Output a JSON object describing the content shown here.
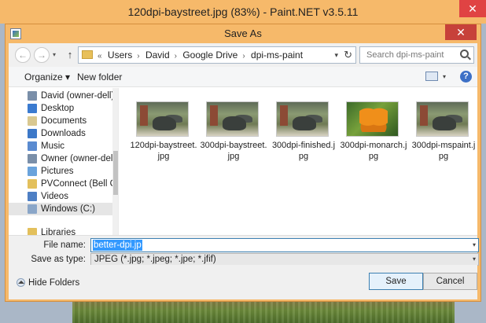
{
  "app": {
    "title": "120dpi-baystreet.jpg (83%) - Paint.NET v3.5.11",
    "close_glyph": "✕"
  },
  "dialog": {
    "title": "Save As",
    "close_glyph": "✕"
  },
  "address_bar": {
    "back_glyph": "←",
    "forward_glyph": "→",
    "up_glyph": "↑",
    "overflow_glyph": "«",
    "crumbs": [
      "Users",
      "David",
      "Google Drive",
      "dpi-ms-paint"
    ],
    "separator_glyph": "›",
    "dropdown_glyph": "▾",
    "refresh_glyph": "↻"
  },
  "search": {
    "placeholder": "Search dpi-ms-paint"
  },
  "toolbar": {
    "organize_label": "Organize ▾",
    "new_folder_label": "New folder",
    "view_dropdown_glyph": "▾",
    "help_glyph": "?"
  },
  "nav_pane": {
    "items": [
      {
        "label": "David (owner-dell)",
        "icon": "user-folder-icon",
        "color": "#7a8fa9"
      },
      {
        "label": "Desktop",
        "icon": "desktop-icon",
        "color": "#3b7bd0"
      },
      {
        "label": "Documents",
        "icon": "documents-icon",
        "color": "#d9c890"
      },
      {
        "label": "Downloads",
        "icon": "downloads-icon",
        "color": "#3c78c8"
      },
      {
        "label": "Music",
        "icon": "music-icon",
        "color": "#5a8bd0"
      },
      {
        "label": "Owner (owner-dell)",
        "icon": "user-folder-icon",
        "color": "#7a8fa9"
      },
      {
        "label": "Pictures",
        "icon": "pictures-icon",
        "color": "#6aa3dc"
      },
      {
        "label": "PVConnect (Bell Conn",
        "icon": "folder-icon",
        "color": "#e3c05c"
      },
      {
        "label": "Videos",
        "icon": "videos-icon",
        "color": "#4e7fc4"
      },
      {
        "label": "Windows (C:)",
        "icon": "drive-icon",
        "color": "#8aa6c8"
      },
      {
        "label": "Libraries",
        "icon": "libraries-icon",
        "color": "#e3c05c"
      }
    ],
    "selected_index": 9
  },
  "files": [
    {
      "label": "120dpi-baystreet.jpg",
      "thumb": "bull"
    },
    {
      "label": "300dpi-baystreet.jpg",
      "thumb": "bull"
    },
    {
      "label": "300dpi-finished.jpg",
      "thumb": "bull"
    },
    {
      "label": "300dpi-monarch.jpg",
      "thumb": "butterfly"
    },
    {
      "label": "300dpi-mspaint.jpg",
      "thumb": "bull"
    }
  ],
  "form": {
    "file_name_label": "File name:",
    "file_name_value": "better-dpi.jp",
    "save_as_type_label": "Save as type:",
    "save_as_type_value": "JPEG (*.jpg; *.jpeg; *.jpe; *.jfif)",
    "dropdown_glyph": "▾"
  },
  "footer": {
    "hide_folders_label": "Hide Folders",
    "save_label": "Save",
    "cancel_label": "Cancel"
  },
  "colors": {
    "title_bar": "#f6b96a",
    "close_button": "#e04343",
    "selection": "#3399ff"
  }
}
